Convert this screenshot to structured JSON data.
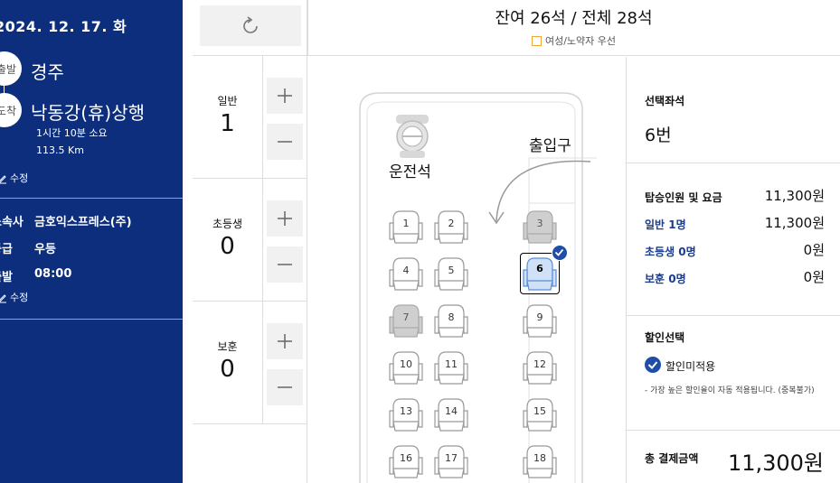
{
  "trip": {
    "date": "2024. 12. 17. 화",
    "depart_badge": "출발",
    "depart_name": "경주",
    "arrive_badge": "도착",
    "arrive_name": "낙동강(휴)상행",
    "duration": "1시간 10분 소요",
    "distance": "113.5 Km",
    "edit_label": "수정",
    "company_label": "소속사",
    "company": "금호익스프레스(주)",
    "grade_label": "등급",
    "grade": "우등",
    "time_label": "출발",
    "time": "08:00",
    "edit_label2": "수정"
  },
  "quantity": {
    "rows": [
      {
        "label": "일반",
        "value": "1"
      },
      {
        "label": "초등생",
        "value": "0"
      },
      {
        "label": "보훈",
        "value": "0"
      }
    ]
  },
  "header": {
    "title": "잔여 26석 / 전체 28석",
    "legend": "여성/노약자 우선"
  },
  "bus": {
    "driver_label": "운전석",
    "exit_label": "출입구",
    "seats": [
      {
        "num": "1",
        "state": "available"
      },
      {
        "num": "2",
        "state": "available"
      },
      {
        "num": "3",
        "state": "taken"
      },
      {
        "num": "4",
        "state": "available"
      },
      {
        "num": "5",
        "state": "available"
      },
      {
        "num": "6",
        "state": "selected"
      },
      {
        "num": "7",
        "state": "taken"
      },
      {
        "num": "8",
        "state": "available"
      },
      {
        "num": "9",
        "state": "available"
      },
      {
        "num": "10",
        "state": "available"
      },
      {
        "num": "11",
        "state": "available"
      },
      {
        "num": "12",
        "state": "available"
      },
      {
        "num": "13",
        "state": "available"
      },
      {
        "num": "14",
        "state": "available"
      },
      {
        "num": "15",
        "state": "available"
      },
      {
        "num": "16",
        "state": "available"
      },
      {
        "num": "17",
        "state": "available"
      },
      {
        "num": "18",
        "state": "available"
      }
    ]
  },
  "summary": {
    "selected_label": "선택좌석",
    "selected_value": "6번",
    "fare_label": "탑승인원 및 요금",
    "fare_value": "11,300원",
    "adult_label": "일반 1명",
    "adult_value": "11,300원",
    "child_label": "초등생 0명",
    "child_value": "0원",
    "veteran_label": "보훈 0명",
    "veteran_value": "0원",
    "discount_label": "할인선택",
    "discount_option": "할인미적용",
    "discount_note": "- 가장 높은 할인율이 자동 적용됩니다. (중복불가)",
    "total_label": "총 결제금액",
    "total_value": "11,300원"
  },
  "colors": {
    "sidebar": "#0d2e7c",
    "accent": "#1e4ea8",
    "selected_seat": "#cfe0f7",
    "taken_seat": "#cfcfcf",
    "priority": "#f0a63a"
  }
}
